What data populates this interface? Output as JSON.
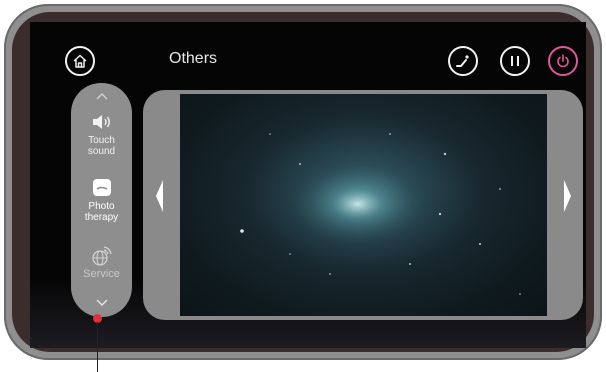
{
  "header": {
    "title": "Others",
    "home_icon": "home-icon",
    "recline_icon": "recline-icon",
    "pause_icon": "pause-icon",
    "power_icon": "power-icon",
    "power_color": "#e2569a"
  },
  "side_menu": {
    "items": [
      {
        "label": "Touch\nsound",
        "icon": "speaker-icon"
      },
      {
        "label": "Photo\ntherapy",
        "icon": "photo-therapy-icon",
        "active": true
      },
      {
        "label": "Service",
        "icon": "service-globe-icon"
      }
    ]
  },
  "content": {
    "prev_icon": "chevron-left-icon",
    "next_icon": "chevron-right-icon"
  },
  "colors": {
    "screen_bg": "#060505",
    "panel_bg": "#8a8a8a",
    "callout": "#e0303c"
  }
}
